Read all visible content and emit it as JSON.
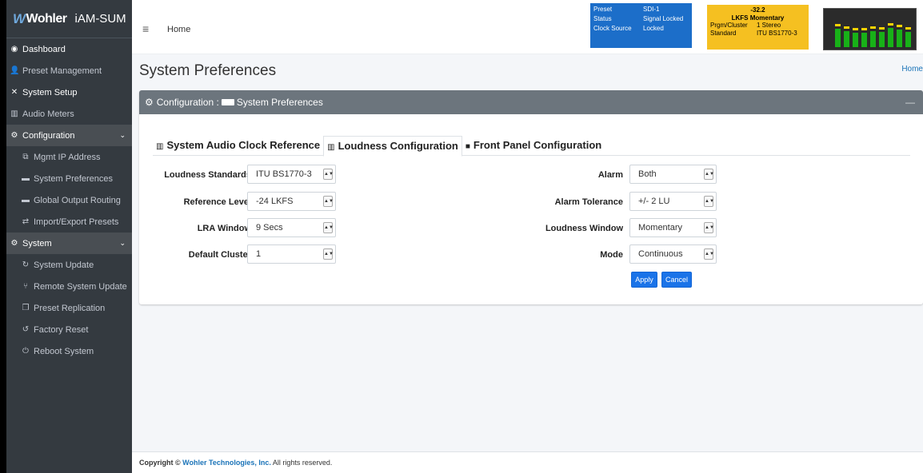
{
  "brand": {
    "logo": "Wohler",
    "app": "iAM-SUM"
  },
  "sidebar": {
    "items": [
      {
        "label": "Dashboard",
        "icon": "dashboard-icon"
      },
      {
        "label": "Preset Management",
        "icon": "user-cog-icon"
      },
      {
        "label": "System Setup",
        "icon": "tools-icon"
      },
      {
        "label": "Audio Meters",
        "icon": "chart-icon"
      },
      {
        "label": "Configuration",
        "icon": "gear-icon"
      },
      {
        "label": "Mgmt IP Address",
        "icon": "network-icon"
      },
      {
        "label": "System Preferences",
        "icon": "keyboard-icon"
      },
      {
        "label": "Global Output Routing",
        "icon": "keyboard-icon"
      },
      {
        "label": "Import/Export Presets",
        "icon": "exchange-icon"
      },
      {
        "label": "System",
        "icon": "cogs-icon"
      },
      {
        "label": "System Update",
        "icon": "sync-icon"
      },
      {
        "label": "Remote System Update",
        "icon": "remote-icon"
      },
      {
        "label": "Preset Replication",
        "icon": "copy-icon"
      },
      {
        "label": "Factory Reset",
        "icon": "undo-icon"
      },
      {
        "label": "Reboot System",
        "icon": "power-icon"
      }
    ]
  },
  "header": {
    "home": "Home",
    "preset_panel": {
      "preset_label": "Preset",
      "preset_value": "SDI-1",
      "status_label": "Status",
      "status_value": "Signal Locked",
      "clock_label": "Clock Source",
      "clock_value": "Locked"
    },
    "lkfs_panel": {
      "value": "-32.2",
      "line": "LKFS  Momentary",
      "cluster_label": "Prgm/Cluster",
      "cluster_value": "1  Stereo",
      "standard_label": "Standard",
      "standard_value": "ITU BS1770-3"
    },
    "meter_levels": [
      0.58,
      0.5,
      0.45,
      0.45,
      0.5,
      0.48,
      0.6,
      0.55,
      0.48
    ],
    "colors": {
      "preset_bg": "#1c6ec9",
      "lkfs_bg": "#f5c021",
      "meter_green": "#18b118"
    }
  },
  "page": {
    "title": "System Preferences",
    "breadcrumb_home": "Home",
    "card_title_prefix": "Configuration :",
    "card_title": "System Preferences",
    "collapse": "—"
  },
  "tabs": [
    {
      "label": "System Audio Clock Reference",
      "icon": "chart-icon"
    },
    {
      "label": "Loudness Configuration",
      "icon": "bar-chart-icon"
    },
    {
      "label": "Front Panel Configuration",
      "icon": "panel-icon"
    }
  ],
  "form": {
    "left": [
      {
        "label": "Loudness Standards",
        "value": "ITU BS1770-3"
      },
      {
        "label": "Reference Level",
        "value": "-24 LKFS"
      },
      {
        "label": "LRA Window",
        "value": "9 Secs"
      },
      {
        "label": "Default Cluster",
        "value": "1"
      }
    ],
    "right": [
      {
        "label": "Alarm",
        "value": "Both"
      },
      {
        "label": "Alarm Tolerance",
        "value": "+/- 2 LU"
      },
      {
        "label": "Loudness Window",
        "value": "Momentary"
      },
      {
        "label": "Mode",
        "value": "Continuous"
      }
    ],
    "apply": "Apply",
    "cancel": "Cancel"
  },
  "footer": {
    "prefix": "Copyright ©",
    "company": "Wohler Technologies, Inc.",
    "suffix": "All rights reserved."
  }
}
